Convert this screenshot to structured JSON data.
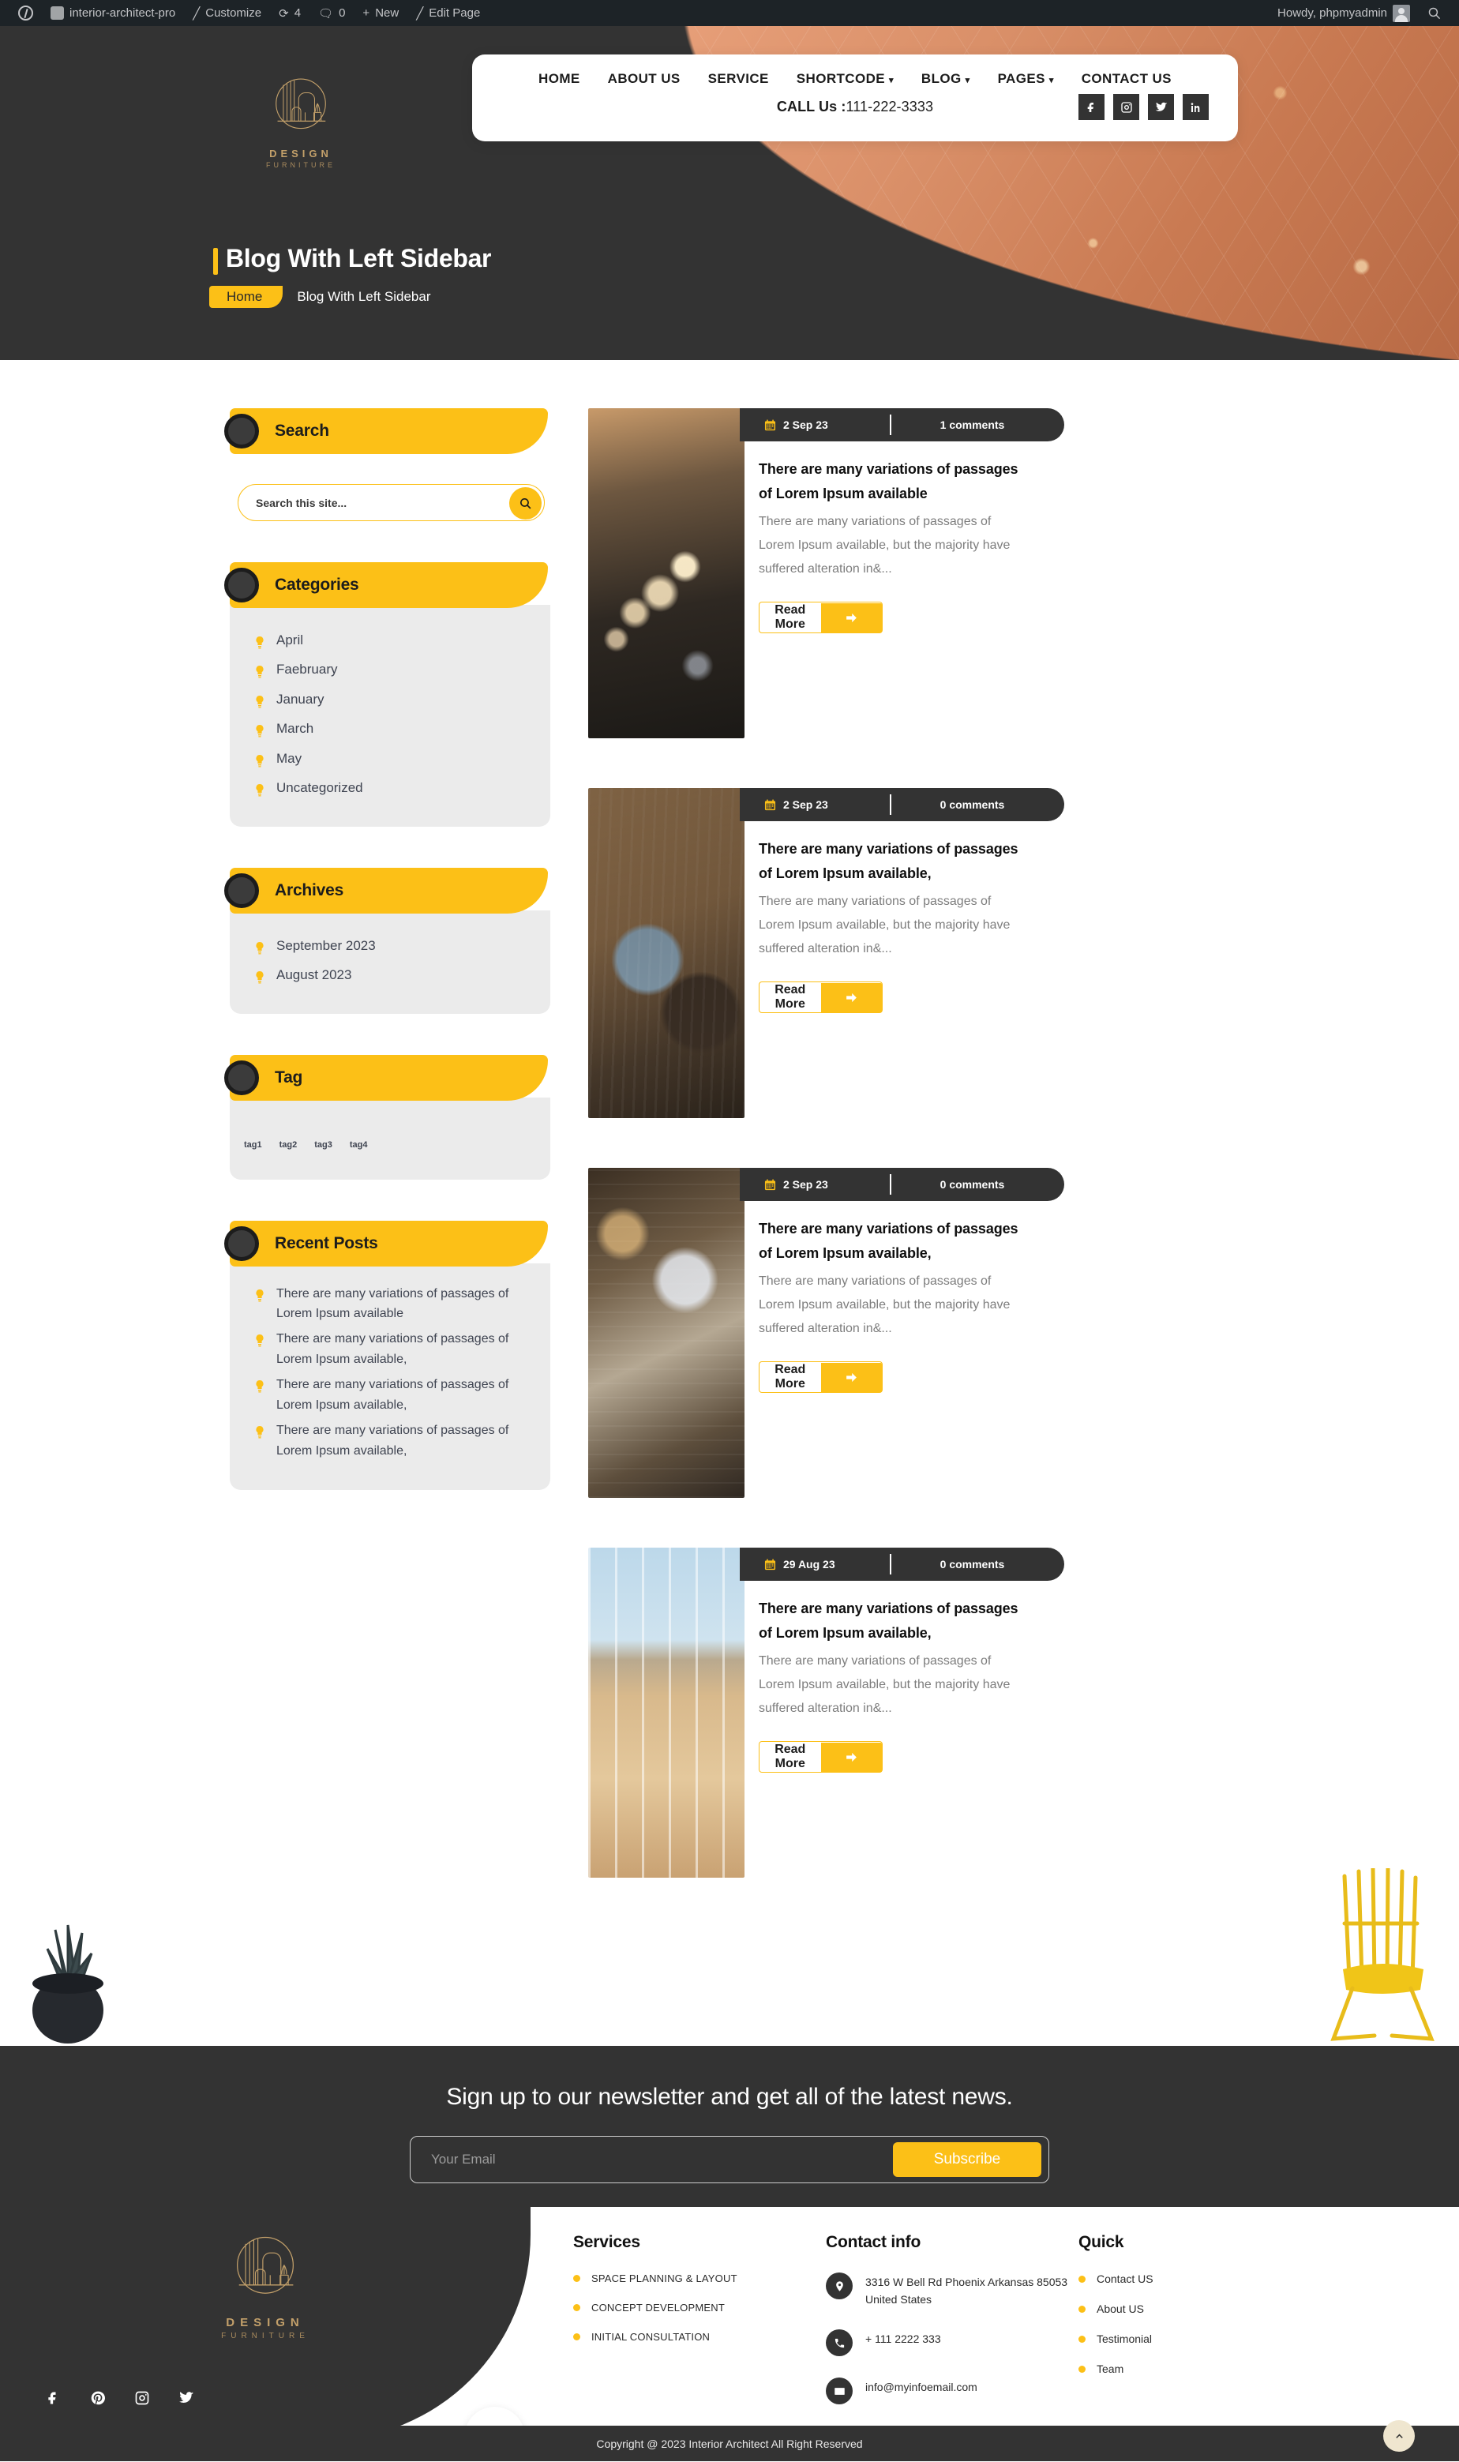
{
  "adminbar": {
    "wp_logo": "wordpress-logo-icon",
    "site_name": "interior-architect-pro",
    "customize": "Customize",
    "updates_count": "4",
    "comments_count": "0",
    "new": "New",
    "edit_page": "Edit Page",
    "howdy": "Howdy, phpmyadmin",
    "search": "search-icon"
  },
  "logo": {
    "name": "DESIGN",
    "sub": "FURNITURE"
  },
  "nav": {
    "items": [
      {
        "label": "HOME",
        "caret": false
      },
      {
        "label": "ABOUT US",
        "caret": false
      },
      {
        "label": "SERVICE",
        "caret": false
      },
      {
        "label": "SHORTCODE",
        "caret": true
      },
      {
        "label": "BLOG",
        "caret": true
      },
      {
        "label": "PAGES",
        "caret": true
      },
      {
        "label": "CONTACT US",
        "caret": false
      }
    ],
    "call_label": "CALL Us : ",
    "call_number": "111-222-3333",
    "socials": [
      "facebook-icon",
      "instagram-icon",
      "twitter-icon",
      "linkedin-icon"
    ]
  },
  "hero": {
    "title": "Blog With Left Sidebar",
    "crumb_home": "Home",
    "crumb_current": "Blog With Left Sidebar"
  },
  "sidebar": {
    "search": {
      "title": "Search",
      "placeholder": "Search this site...",
      "value": "",
      "button": "search-icon"
    },
    "categories": {
      "title": "Categories",
      "items": [
        "April",
        "Faebruary",
        "January",
        "March",
        "May",
        "Uncategorized"
      ]
    },
    "archives": {
      "title": "Archives",
      "items": [
        "September 2023",
        "August 2023"
      ]
    },
    "tag": {
      "title": "Tag",
      "items": [
        "tag1",
        "tag2",
        "tag3",
        "tag4"
      ]
    },
    "recent_posts": {
      "title": "Recent Posts",
      "items": [
        "There are many variations of passages of Lorem Ipsum available",
        "There are many variations of passages of Lorem Ipsum available,",
        "There are many variations of passages of Lorem Ipsum available,",
        "There are many variations of passages of Lorem Ipsum available,"
      ]
    }
  },
  "posts": [
    {
      "date": "2 Sep 23",
      "comments": "1 comments",
      "title": "There are many variations of passages of Lorem Ipsum available",
      "excerpt": "There are many variations of passages of Lorem Ipsum available, but the majority have suffered alteration in&...",
      "read_more": "Read More",
      "thumb": "pendant-lights-photo"
    },
    {
      "date": "2 Sep 23",
      "comments": "0 comments",
      "title": "There are many variations of passages of Lorem Ipsum available,",
      "excerpt": "There are many variations of passages of Lorem Ipsum available, but the majority have suffered alteration in&...",
      "read_more": "Read More",
      "thumb": "cafe-interior-photo"
    },
    {
      "date": "2 Sep 23",
      "comments": "0 comments",
      "title": "There are many variations of passages of Lorem Ipsum available,",
      "excerpt": "There are many variations of passages of Lorem Ipsum available, but the majority have suffered alteration in&...",
      "read_more": "Read More",
      "thumb": "brick-loft-photo"
    },
    {
      "date": "29 Aug 23",
      "comments": "0 comments",
      "title": "There are many variations of passages of Lorem Ipsum available,",
      "excerpt": "There are many variations of passages of Lorem Ipsum available, but the majority have suffered alteration in&...",
      "read_more": "Read More",
      "thumb": "balcony-doors-photo"
    }
  ],
  "newsletter": {
    "title": "Sign up to our newsletter and get all of the latest news.",
    "placeholder": "Your Email",
    "value": "",
    "button": "Subscribe"
  },
  "footer": {
    "logo": {
      "name": "DESIGN",
      "sub": "FURNITURE"
    },
    "socials": [
      "facebook-icon",
      "pinterest-icon",
      "instagram-icon",
      "twitter-icon"
    ],
    "services": {
      "heading": "Services",
      "items": [
        "SPACE PLANNING & LAYOUT",
        "CONCEPT DEVELOPMENT",
        "INITIAL CONSULTATION"
      ]
    },
    "contact": {
      "heading": "Contact info",
      "address": "3316 W Bell Rd Phoenix Arkansas 85053 United States",
      "phone": "+ 111 2222 333",
      "email": "info@myinfoemail.com"
    },
    "quick": {
      "heading": "Quick",
      "items": [
        "Contact US",
        "About US",
        "Testimonial",
        "Team"
      ]
    },
    "copyright": "Copyright @ 2023 Interior Architect All Right Reserved",
    "scroll_top": "chevron-up-icon"
  },
  "colors": {
    "accent": "#fcc017",
    "dark": "#333333",
    "logo_gold": "#c3a06a"
  }
}
